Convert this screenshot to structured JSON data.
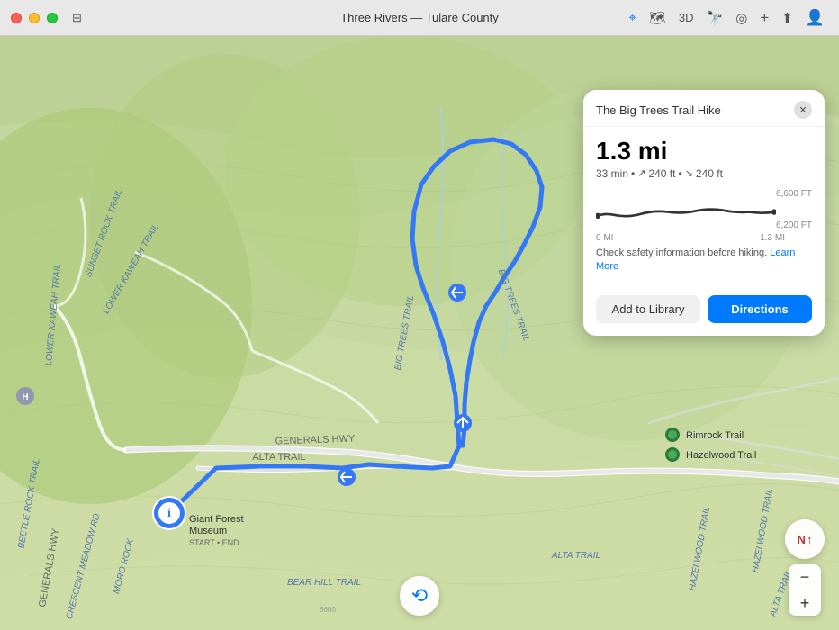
{
  "window": {
    "title": "Three Rivers — Tulare County",
    "traffic_light_close": "close",
    "traffic_light_min": "minimize",
    "traffic_light_max": "maximize"
  },
  "titlebar": {
    "controls": [
      "location-icon",
      "map-icon",
      "3d-label",
      "binoculars-icon",
      "location2-icon",
      "add-icon",
      "share-icon",
      "account-icon"
    ]
  },
  "map": {
    "region": "Three Rivers, Tulare County",
    "trail_name": "Big Trees Trail Hike"
  },
  "info_card": {
    "title": "The Big Trees Trail Hike",
    "close_label": "✕",
    "distance": "1.3 mi",
    "time": "33 min",
    "elevation_gain": "240 ft",
    "elevation_loss": "240 ft",
    "elevation_max_label": "6,600 FT",
    "elevation_min_label": "6,200 FT",
    "distance_start": "0 MI",
    "distance_end": "1.3 MI",
    "warning": "Check safety information before hiking.",
    "learn_more": "Learn More",
    "add_library_label": "Add to Library",
    "directions_label": "Directions"
  },
  "map_controls": {
    "zoom_in": "+",
    "zoom_out": "−",
    "compass": "N",
    "recenter": "⟲"
  },
  "poi": [
    {
      "name": "Giant Forest Museum",
      "sub": "START • END",
      "type": "museum"
    },
    {
      "name": "Rimrock Trail",
      "type": "trail"
    },
    {
      "name": "Hazelwood Trail",
      "type": "trail"
    }
  ],
  "roads": [
    "Generals Hwy",
    "Alta Trail",
    "Big Trees Trail",
    "Sunset Rock Trail",
    "Lower Kaweah Trail"
  ],
  "colors": {
    "map_bg": "#c8d9a0",
    "trail_blue": "#3478f6",
    "road_white": "#ffffff",
    "card_bg": "#ffffff",
    "directions_btn": "#007aff",
    "library_btn": "#f0f0f0"
  }
}
